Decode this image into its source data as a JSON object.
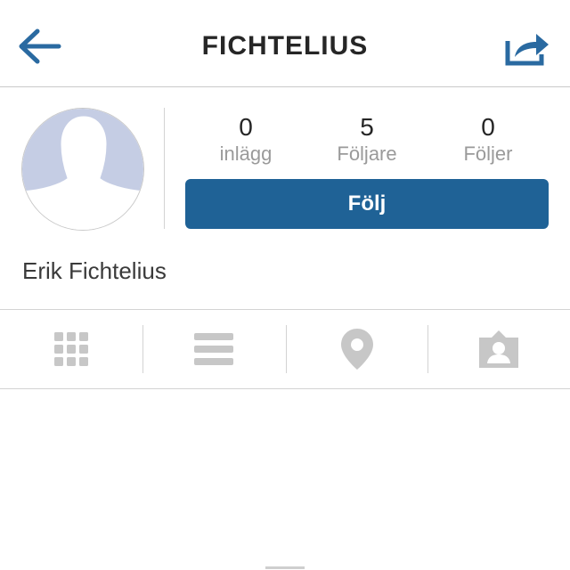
{
  "header": {
    "title": "FICHTELIUS",
    "back_icon": "arrow-left-icon",
    "share_icon": "share-icon"
  },
  "profile": {
    "avatar_icon": "default-avatar-icon",
    "full_name": "Erik Fichtelius",
    "stats": [
      {
        "value": "0",
        "label": "inlägg"
      },
      {
        "value": "5",
        "label": "Följare"
      },
      {
        "value": "0",
        "label": "Följer"
      }
    ],
    "follow_button": "Följ"
  },
  "tabs": [
    {
      "icon": "grid-icon"
    },
    {
      "icon": "list-icon"
    },
    {
      "icon": "location-pin-icon"
    },
    {
      "icon": "tagged-person-icon"
    }
  ],
  "colors": {
    "accent": "#1f6296",
    "icon_blue": "#2a6aa1",
    "tab_icon_gray": "#c7c7c7",
    "avatar_fill": "#c5cde4"
  }
}
